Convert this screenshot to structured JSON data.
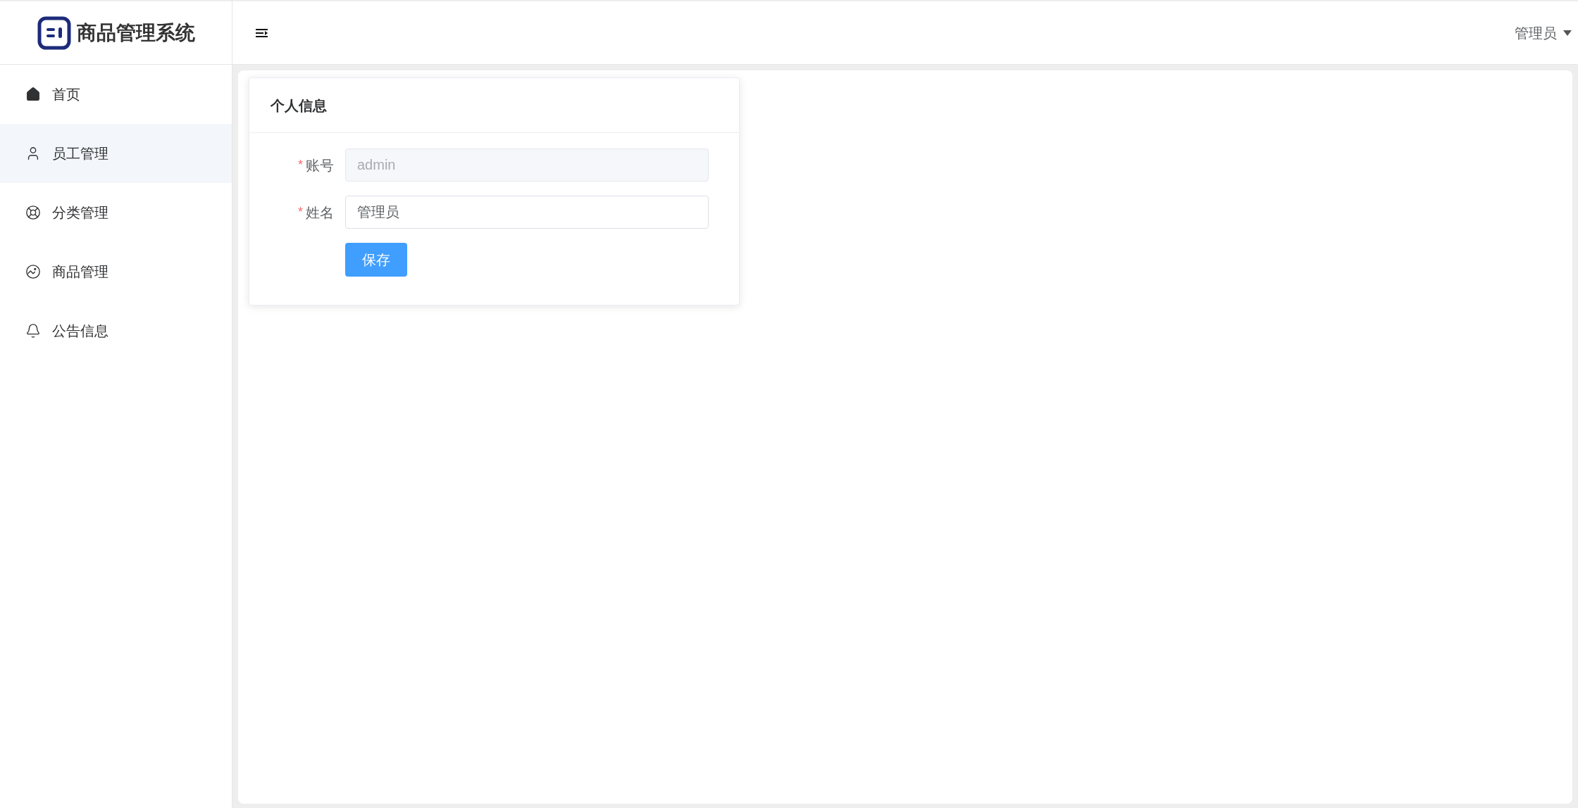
{
  "sidebar": {
    "title": "商品管理系统",
    "items": [
      {
        "label": "首页",
        "selected": false
      },
      {
        "label": "员工管理",
        "selected": true
      },
      {
        "label": "分类管理",
        "selected": false
      },
      {
        "label": "商品管理",
        "selected": false
      },
      {
        "label": "公告信息",
        "selected": false
      }
    ]
  },
  "header": {
    "user": "管理员"
  },
  "card": {
    "title": "个人信息",
    "fields": [
      {
        "mark": "*",
        "label": "账号",
        "disabled": true,
        "value": "admin"
      },
      {
        "mark": "*",
        "label": "姓名",
        "disabled": false,
        "value": "管理员"
      }
    ],
    "button": "保存"
  }
}
